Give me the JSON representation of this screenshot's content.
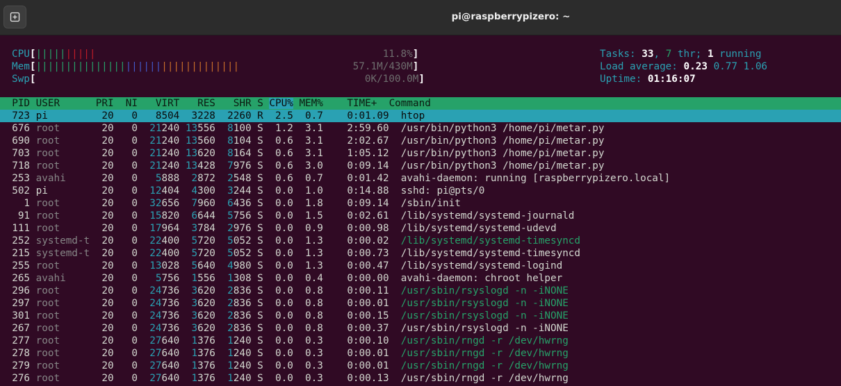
{
  "window": {
    "title": "pi@raspberrypizero: ~",
    "new_tab_icon": "new-tab-icon"
  },
  "meters": {
    "cpu": {
      "label": "CPU",
      "percent": "11.8%",
      "value": 0.118
    },
    "mem": {
      "label": "Mem",
      "value_text": "57.1M/430M"
    },
    "swp": {
      "label": "Swp",
      "value_text": "0K/100.0M"
    }
  },
  "summary": {
    "tasks_label": "Tasks: ",
    "tasks": "33",
    "thr": "7",
    "thr_label": " thr; ",
    "running": "1",
    "running_label": " running",
    "load_label": "Load average: ",
    "load1": "0.23",
    "load5": "0.77",
    "load15": "1.06",
    "uptime_label": "Uptime: ",
    "uptime": "01:16:07"
  },
  "columns": [
    "PID",
    "USER",
    "PRI",
    "NI",
    "VIRT",
    "RES",
    "SHR",
    "S",
    "CPU%",
    "MEM%",
    "TIME+",
    "Command"
  ],
  "colors": {
    "header_bg": "#26a269",
    "selected_bg": "#2aa1b3",
    "terminal_bg": "#300a24"
  },
  "processes": [
    {
      "pid": "723",
      "user": "pi",
      "pri": "20",
      "ni": "0",
      "virt": "8504",
      "res": "3228",
      "shr": "2260",
      "s": "R",
      "cpu": "2.5",
      "mem": "0.7",
      "time": "0:01.09",
      "cmd": "htop",
      "thread": false,
      "selected": true
    },
    {
      "pid": "676",
      "user": "root",
      "pri": "20",
      "ni": "0",
      "virt": "21240",
      "res": "13556",
      "shr": "8100",
      "s": "S",
      "cpu": "1.2",
      "mem": "3.1",
      "time": "2:59.60",
      "cmd": "/usr/bin/python3 /home/pi/metar.py",
      "thread": false
    },
    {
      "pid": "690",
      "user": "root",
      "pri": "20",
      "ni": "0",
      "virt": "21240",
      "res": "13560",
      "shr": "8104",
      "s": "S",
      "cpu": "0.6",
      "mem": "3.1",
      "time": "2:02.67",
      "cmd": "/usr/bin/python3 /home/pi/metar.py",
      "thread": false
    },
    {
      "pid": "703",
      "user": "root",
      "pri": "20",
      "ni": "0",
      "virt": "21240",
      "res": "13620",
      "shr": "8164",
      "s": "S",
      "cpu": "0.6",
      "mem": "3.1",
      "time": "1:05.12",
      "cmd": "/usr/bin/python3 /home/pi/metar.py",
      "thread": false
    },
    {
      "pid": "718",
      "user": "root",
      "pri": "20",
      "ni": "0",
      "virt": "21240",
      "res": "13428",
      "shr": "7976",
      "s": "S",
      "cpu": "0.6",
      "mem": "3.0",
      "time": "0:09.14",
      "cmd": "/usr/bin/python3 /home/pi/metar.py",
      "thread": false
    },
    {
      "pid": "253",
      "user": "avahi",
      "pri": "20",
      "ni": "0",
      "virt": "5888",
      "res": "2872",
      "shr": "2548",
      "s": "S",
      "cpu": "0.6",
      "mem": "0.7",
      "time": "0:01.42",
      "cmd": "avahi-daemon: running [raspberrypizero.local]",
      "thread": false
    },
    {
      "pid": "502",
      "user": "pi",
      "pri": "20",
      "ni": "0",
      "virt": "12404",
      "res": "4300",
      "shr": "3244",
      "s": "S",
      "cpu": "0.0",
      "mem": "1.0",
      "time": "0:14.88",
      "cmd": "sshd: pi@pts/0",
      "thread": false
    },
    {
      "pid": "1",
      "user": "root",
      "pri": "20",
      "ni": "0",
      "virt": "32656",
      "res": "7960",
      "shr": "6436",
      "s": "S",
      "cpu": "0.0",
      "mem": "1.8",
      "time": "0:09.14",
      "cmd": "/sbin/init",
      "thread": false
    },
    {
      "pid": "91",
      "user": "root",
      "pri": "20",
      "ni": "0",
      "virt": "15820",
      "res": "6644",
      "shr": "5756",
      "s": "S",
      "cpu": "0.0",
      "mem": "1.5",
      "time": "0:02.61",
      "cmd": "/lib/systemd/systemd-journald",
      "thread": false
    },
    {
      "pid": "111",
      "user": "root",
      "pri": "20",
      "ni": "0",
      "virt": "17964",
      "res": "3784",
      "shr": "2976",
      "s": "S",
      "cpu": "0.0",
      "mem": "0.9",
      "time": "0:00.98",
      "cmd": "/lib/systemd/systemd-udevd",
      "thread": false
    },
    {
      "pid": "252",
      "user": "systemd-t",
      "pri": "20",
      "ni": "0",
      "virt": "22400",
      "res": "5720",
      "shr": "5052",
      "s": "S",
      "cpu": "0.0",
      "mem": "1.3",
      "time": "0:00.02",
      "cmd": "/lib/systemd/systemd-timesyncd",
      "thread": true
    },
    {
      "pid": "215",
      "user": "systemd-t",
      "pri": "20",
      "ni": "0",
      "virt": "22400",
      "res": "5720",
      "shr": "5052",
      "s": "S",
      "cpu": "0.0",
      "mem": "1.3",
      "time": "0:00.73",
      "cmd": "/lib/systemd/systemd-timesyncd",
      "thread": false
    },
    {
      "pid": "255",
      "user": "root",
      "pri": "20",
      "ni": "0",
      "virt": "13028",
      "res": "5640",
      "shr": "4980",
      "s": "S",
      "cpu": "0.0",
      "mem": "1.3",
      "time": "0:00.47",
      "cmd": "/lib/systemd/systemd-logind",
      "thread": false
    },
    {
      "pid": "265",
      "user": "avahi",
      "pri": "20",
      "ni": "0",
      "virt": "5756",
      "res": "1556",
      "shr": "1308",
      "s": "S",
      "cpu": "0.0",
      "mem": "0.4",
      "time": "0:00.00",
      "cmd": "avahi-daemon: chroot helper",
      "thread": false
    },
    {
      "pid": "296",
      "user": "root",
      "pri": "20",
      "ni": "0",
      "virt": "24736",
      "res": "3620",
      "shr": "2836",
      "s": "S",
      "cpu": "0.0",
      "mem": "0.8",
      "time": "0:00.11",
      "cmd": "/usr/sbin/rsyslogd -n -iNONE",
      "thread": true
    },
    {
      "pid": "297",
      "user": "root",
      "pri": "20",
      "ni": "0",
      "virt": "24736",
      "res": "3620",
      "shr": "2836",
      "s": "S",
      "cpu": "0.0",
      "mem": "0.8",
      "time": "0:00.01",
      "cmd": "/usr/sbin/rsyslogd -n -iNONE",
      "thread": true
    },
    {
      "pid": "301",
      "user": "root",
      "pri": "20",
      "ni": "0",
      "virt": "24736",
      "res": "3620",
      "shr": "2836",
      "s": "S",
      "cpu": "0.0",
      "mem": "0.8",
      "time": "0:00.15",
      "cmd": "/usr/sbin/rsyslogd -n -iNONE",
      "thread": true
    },
    {
      "pid": "267",
      "user": "root",
      "pri": "20",
      "ni": "0",
      "virt": "24736",
      "res": "3620",
      "shr": "2836",
      "s": "S",
      "cpu": "0.0",
      "mem": "0.8",
      "time": "0:00.37",
      "cmd": "/usr/sbin/rsyslogd -n -iNONE",
      "thread": false
    },
    {
      "pid": "277",
      "user": "root",
      "pri": "20",
      "ni": "0",
      "virt": "27640",
      "res": "1376",
      "shr": "1240",
      "s": "S",
      "cpu": "0.0",
      "mem": "0.3",
      "time": "0:00.10",
      "cmd": "/usr/sbin/rngd -r /dev/hwrng",
      "thread": true
    },
    {
      "pid": "278",
      "user": "root",
      "pri": "20",
      "ni": "0",
      "virt": "27640",
      "res": "1376",
      "shr": "1240",
      "s": "S",
      "cpu": "0.0",
      "mem": "0.3",
      "time": "0:00.01",
      "cmd": "/usr/sbin/rngd -r /dev/hwrng",
      "thread": true
    },
    {
      "pid": "279",
      "user": "root",
      "pri": "20",
      "ni": "0",
      "virt": "27640",
      "res": "1376",
      "shr": "1240",
      "s": "S",
      "cpu": "0.0",
      "mem": "0.3",
      "time": "0:00.01",
      "cmd": "/usr/sbin/rngd -r /dev/hwrng",
      "thread": true
    },
    {
      "pid": "276",
      "user": "root",
      "pri": "20",
      "ni": "0",
      "virt": "27640",
      "res": "1376",
      "shr": "1240",
      "s": "S",
      "cpu": "0.0",
      "mem": "0.3",
      "time": "0:00.13",
      "cmd": "/usr/sbin/rngd -r /dev/hwrng",
      "thread": false
    }
  ]
}
